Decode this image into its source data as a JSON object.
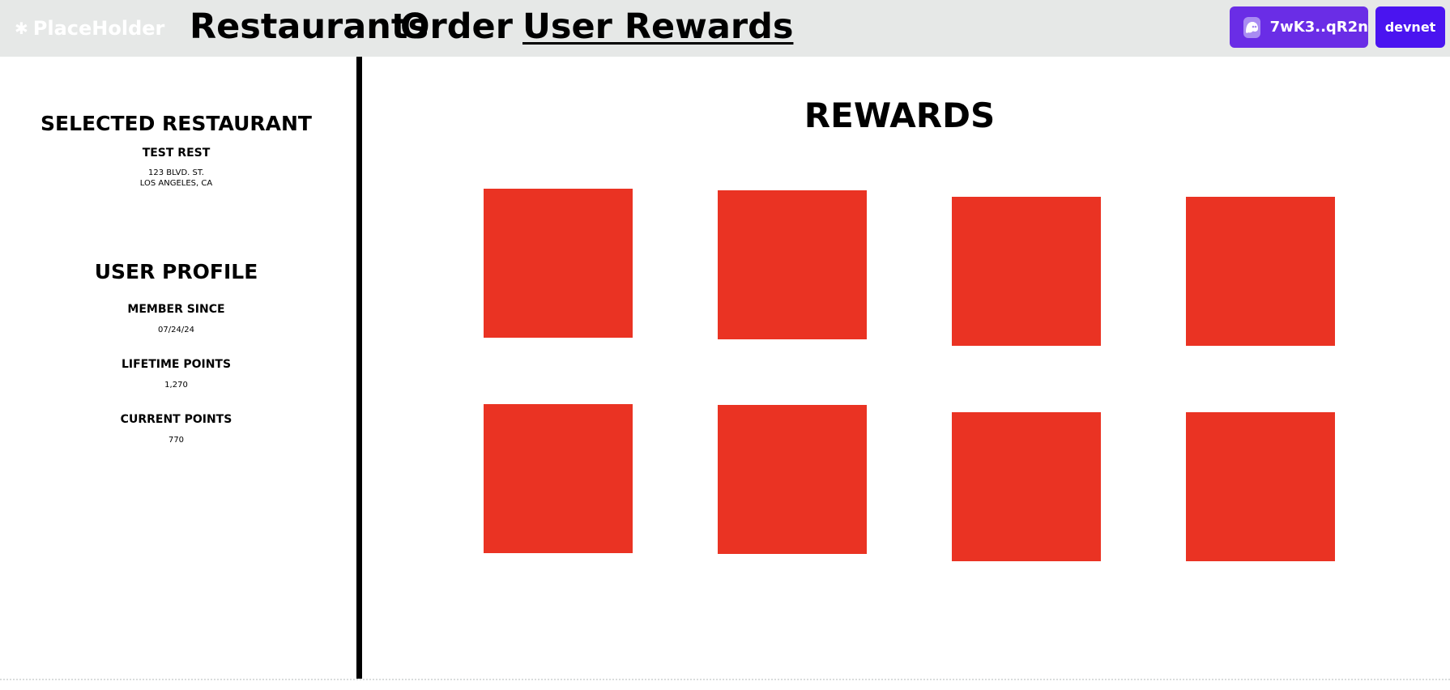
{
  "header": {
    "logo": "PlaceHolder",
    "nav": [
      {
        "label": "Restaurants",
        "active": false
      },
      {
        "label": "Order",
        "active": false
      },
      {
        "label": "User Rewards",
        "active": true
      }
    ],
    "wallet": {
      "label": "7wK3..qR2n",
      "icon": "ghost-icon"
    },
    "network": {
      "label": "devnet"
    }
  },
  "sidebar": {
    "restaurant": {
      "heading": "SELECTED RESTAURANT",
      "name": "TEST REST",
      "address_line1": "123 BLVD. ST.",
      "address_line2": "LOS ANGELES, CA"
    },
    "profile": {
      "heading": "USER PROFILE",
      "member_since_label": "MEMBER SINCE",
      "member_since_value": "07/24/24",
      "lifetime_points_label": "LIFETIME POINTS",
      "lifetime_points_value": "1,270",
      "current_points_label": "CURRENT POINTS",
      "current_points_value": "770"
    }
  },
  "main": {
    "title": "REWARDS",
    "tile_color": "#ea3323",
    "tile_count": 8
  },
  "colors": {
    "topbar": "#e6e8e7",
    "wallet": "#6a2de6",
    "network": "#4a14f0",
    "reward": "#ea3323"
  }
}
